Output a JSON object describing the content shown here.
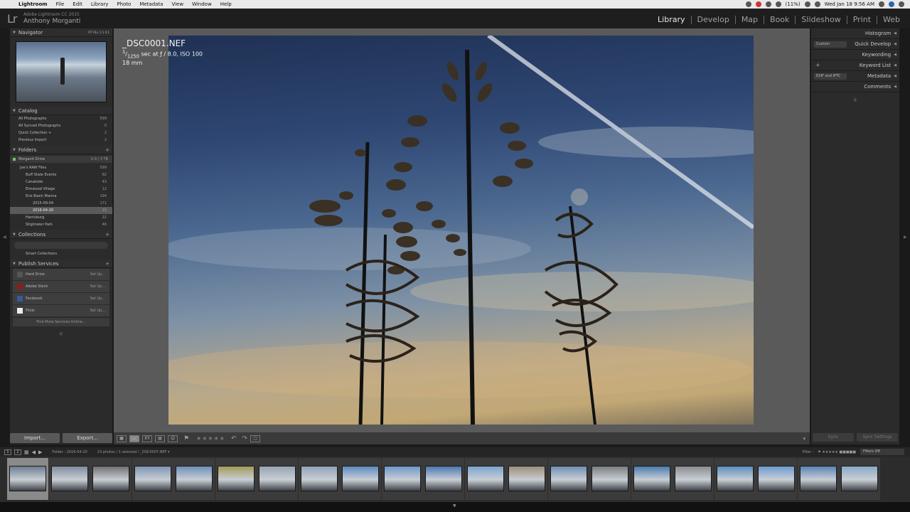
{
  "menubar": {
    "app_name": "Lightroom",
    "menus": [
      "File",
      "Edit",
      "Library",
      "Photo",
      "Metadata",
      "View",
      "Window",
      "Help"
    ],
    "battery": "(11%)",
    "datetime": "Wed Jan 18  9:56 AM"
  },
  "header": {
    "logo": "Lr",
    "version": "Adobe Lightroom CC 2015",
    "user": "Anthony Morganti",
    "modules": [
      "Library",
      "Develop",
      "Map",
      "Book",
      "Slideshow",
      "Print",
      "Web"
    ],
    "active_module": "Library"
  },
  "left_panel": {
    "navigator": {
      "title": "Navigator",
      "options": "FIT   FILL   1:1   4:1"
    },
    "catalog": {
      "title": "Catalog",
      "items": [
        {
          "label": "All Photographs",
          "count": "599"
        },
        {
          "label": "All Synced Photographs",
          "count": "0"
        },
        {
          "label": "Quick Collection +",
          "count": "2"
        },
        {
          "label": "Previous Import",
          "count": "2"
        }
      ]
    },
    "folders": {
      "title": "Folders",
      "volume": {
        "name": "Morganti Drive",
        "count": "0.9 / 3 TB"
      },
      "items": [
        {
          "label": "Joe's RAW Files",
          "count": "599"
        },
        {
          "label": "Buff State Events",
          "count": "82"
        },
        {
          "label": "Canalside",
          "count": "43"
        },
        {
          "label": "Elmwood Village",
          "count": "12"
        },
        {
          "label": "Erie Basin Marina",
          "count": "194"
        },
        {
          "label": "2015-09-04",
          "count": "171"
        },
        {
          "label": "2016-04-20",
          "count": "23"
        },
        {
          "label": "Harrisburg",
          "count": "22"
        },
        {
          "label": "Stiglmeier Park",
          "count": "46"
        }
      ]
    },
    "collections": {
      "title": "Collections",
      "smart": "Smart Collections"
    },
    "publish": {
      "title": "Publish Services",
      "items": [
        {
          "label": "Hard Drive",
          "action": "Set Up..."
        },
        {
          "label": "Adobe Stock",
          "action": "Set Up..."
        },
        {
          "label": "Facebook",
          "action": "Set Up..."
        },
        {
          "label": "Flickr",
          "action": "Set Up..."
        }
      ],
      "find_more": "Find More Services Online..."
    },
    "import_label": "Import...",
    "export_label": "Export..."
  },
  "center": {
    "filename": "_DSC0001.NEF",
    "exif_shutter_num": "1",
    "exif_shutter_den": "1250",
    "exif_rest": " sec at ƒ / 8.0, ISO 100",
    "focal": "18 mm"
  },
  "right_panel": {
    "histogram": "Histogram",
    "quick_develop": "Quick Develop",
    "quick_develop_preset": "Custom",
    "keywording": "Keywording",
    "keyword_list": "Keyword List",
    "metadata": "Metadata",
    "metadata_preset": "EXIF and IPTC",
    "comments": "Comments",
    "sync_label": "Sync",
    "sync_settings_label": "Sync Settings"
  },
  "filmstrip": {
    "page1": "1",
    "page2": "2",
    "source": "Folder : 2016-04-20",
    "info": "23 photos / 1 selected / _DSC0007.NEF ▾",
    "filter_label": "Filter :",
    "filter_value": "Filters Off",
    "thumb_colors": [
      "#6c7d92",
      "#7f8da0",
      "#6e6f6f",
      "#7d96b4",
      "#6d8fb8",
      "#a39a5a",
      "#95a4b4",
      "#8fa2b9",
      "#5d8ac0",
      "#6d98c8",
      "#4b78b0",
      "#7aa4cf",
      "#9a8e7a",
      "#6e8fb2",
      "#7a7d80",
      "#4a7cad",
      "#8b8d90",
      "#5b8cc0",
      "#6b9ad0",
      "#5a84b6",
      "#8aa9c6"
    ]
  }
}
